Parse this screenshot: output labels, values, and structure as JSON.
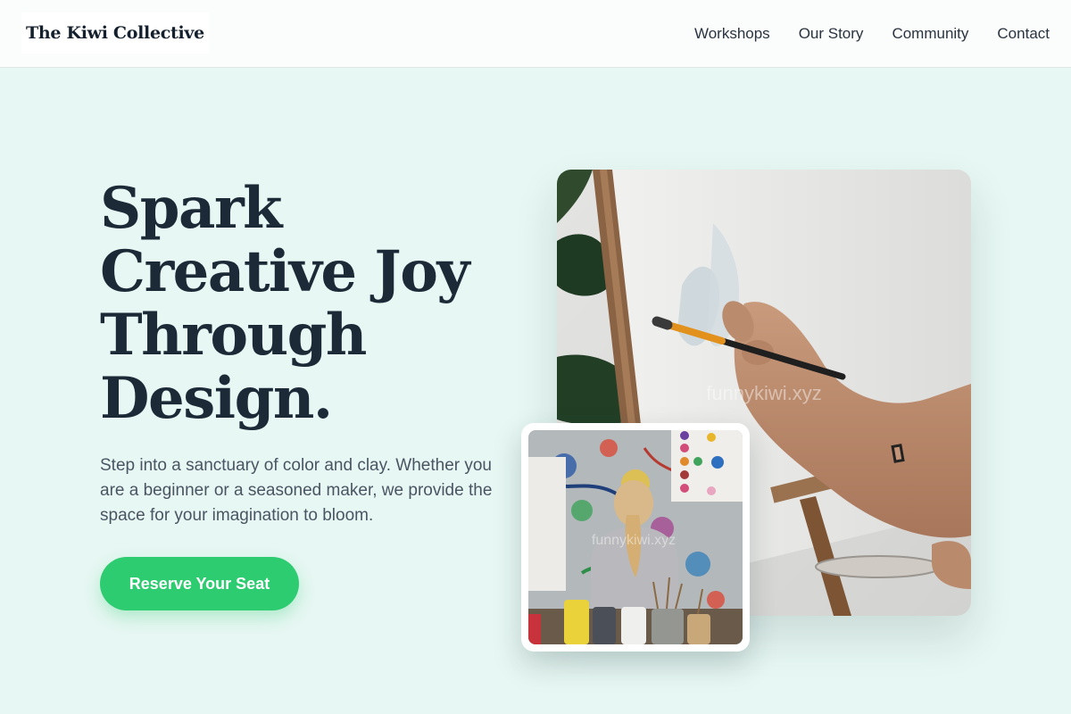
{
  "brand": {
    "name": "The Kiwi Collective"
  },
  "nav": {
    "items": [
      {
        "label": "Workshops"
      },
      {
        "label": "Our Story"
      },
      {
        "label": "Community"
      },
      {
        "label": "Contact"
      }
    ]
  },
  "hero": {
    "title_lines": [
      "Spark",
      "Creative Joy",
      "Through",
      "Design."
    ],
    "description": "Step into a sanctuary of color and clay. Whether you are a beginner or a seasoned maker, we provide the space for your imagination to bloom.",
    "cta_label": "Reserve Your Seat"
  },
  "images": {
    "main_watermark": "funnykiwi.xyz",
    "secondary_watermark": "funnykiwi.xyz"
  },
  "colors": {
    "background": "#e7f7f3",
    "header": "#fbfdfc",
    "accent": "#2ecc71",
    "heading": "#1c2a38",
    "body_text": "#4a5563"
  }
}
